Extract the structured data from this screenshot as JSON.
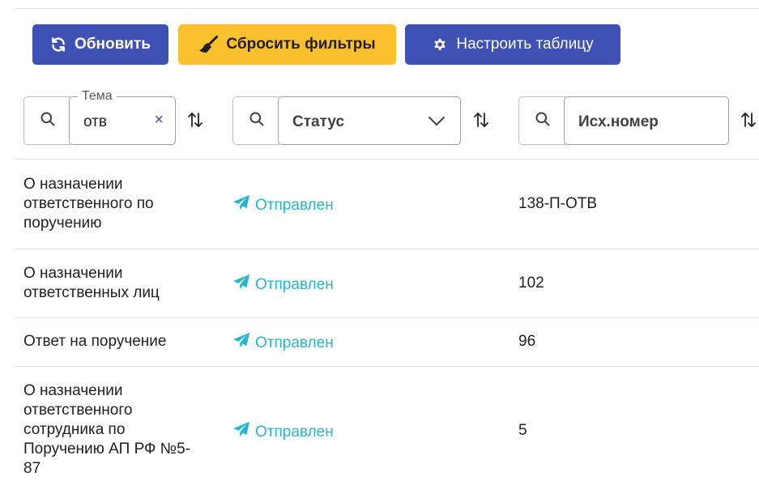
{
  "toolbar": {
    "refresh_label": "Обновить",
    "reset_filters_label": "Сбросить фильтры",
    "configure_table_label": "Настроить таблицу"
  },
  "filters": {
    "topic": {
      "label": "Тема",
      "value": "отв",
      "clear": "×"
    },
    "status": {
      "placeholder": "Статус"
    },
    "out_number": {
      "placeholder": "Исх.номер"
    }
  },
  "rows": [
    {
      "topic": "О назначении ответственного по поручению",
      "status": "Отправлен",
      "number": "138-П-ОТВ"
    },
    {
      "topic": "О назначении ответственных лиц",
      "status": "Отправлен",
      "number": "102"
    },
    {
      "topic": "Ответ на поручение",
      "status": "Отправлен",
      "number": "96"
    },
    {
      "topic": "О назначении ответственного сотрудника по Поручению АП РФ №5-87",
      "status": "Отправлен",
      "number": "5"
    }
  ],
  "colors": {
    "primary": "#3f51b5",
    "warning": "#fbc02d",
    "status_sent": "#26b5cf"
  },
  "icons": {
    "refresh": "sync-icon",
    "reset": "broom-icon",
    "configure": "gear-icon",
    "search": "search-icon",
    "sort": "sort-icon",
    "status": "paper-plane-icon"
  }
}
